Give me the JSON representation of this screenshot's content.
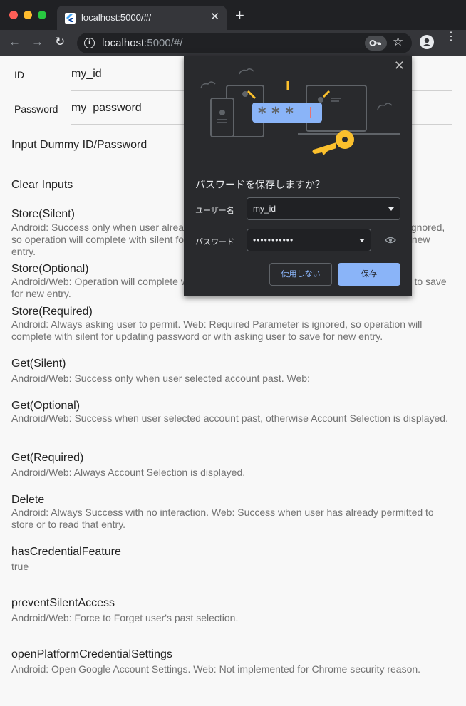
{
  "browser": {
    "tab_title": "localhost:5000/#/",
    "tab_close": "✕",
    "new_tab": "+",
    "url_host": "localhost",
    "url_rest": ":5000/#/"
  },
  "form": {
    "id_label": "ID",
    "id_value": "my_id",
    "password_label": "Password",
    "password_value": "my_password",
    "dummy_button": "Input Dummy ID/Password",
    "clear_button": "Clear Inputs"
  },
  "items": [
    {
      "title": "Store(Silent)",
      "desc": "Android: Success only when user already permitted to store. Web: Required Parameter is ignored, so operation will complete with silent for updating password or with asking user to save for new entry."
    },
    {
      "title": "Store(Optional)",
      "desc": "Android/Web: Operation will complete with silent for updating password or with asking user to save for new entry."
    },
    {
      "title": "Store(Required)",
      "desc": "Android: Always asking user to permit. Web: Required Parameter is ignored, so operation will complete with silent for updating password or with asking user to save for new entry."
    },
    {
      "title": "Get(Silent)",
      "desc": "Android/Web: Success only when user selected account past. Web:"
    },
    {
      "title": "Get(Optional)",
      "desc": "Android/Web: Success when user selected account past, otherwise Account Selection is displayed."
    },
    {
      "title": "Get(Required)",
      "desc": "Android/Web: Always Account Selection is displayed."
    },
    {
      "title": "Delete",
      "desc": "Android: Always Success with no interaction. Web: Success when user has already permitted to store or to read that entry."
    },
    {
      "title": "hasCredentialFeature",
      "desc": "true"
    },
    {
      "title": "preventSilentAccess",
      "desc": "Android/Web: Force to Forget user's past selection."
    },
    {
      "title": "openPlatformCredentialSettings",
      "desc": "Android: Open Google Account Settings. Web: Not implemented for Chrome security reason."
    }
  ],
  "dialog": {
    "close": "✕",
    "title": "パスワードを保存しますか？",
    "username_label": "ユーザー名",
    "username_value": "my_id",
    "password_label": "パスワード",
    "password_value": "•••••••••••",
    "never_button": "使用しない",
    "save_button": "保存",
    "illustration_text": "* * *"
  },
  "colors": {
    "accent": "#8ab4f8",
    "dialog_bg": "#292a2d",
    "key_gold": "#fbc02d"
  }
}
